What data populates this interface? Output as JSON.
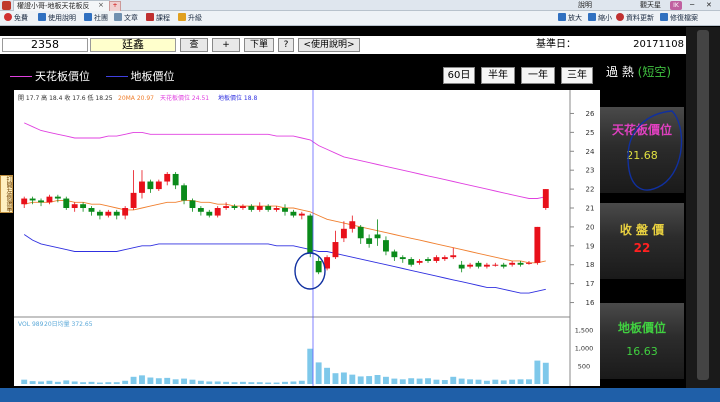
{
  "window": {
    "tab_title": "權證小哥-地板天花板反",
    "tab_close": "×"
  },
  "titlebar_right": {
    "help": "說明",
    "user": "觀天星",
    "user_badge": "IK"
  },
  "toolbar": {
    "items": [
      {
        "label": "免費",
        "color": "#d03030"
      },
      {
        "label": "使用說明",
        "color": "#3070c0"
      },
      {
        "label": "社團",
        "color": "#3070c0"
      },
      {
        "label": "文章",
        "color": "#3070c0"
      },
      {
        "label": "課程",
        "color": "#c03030"
      },
      {
        "label": "升級",
        "color": "#e0a020"
      }
    ],
    "right_items": [
      {
        "label": "放大",
        "color": "#3070c0"
      },
      {
        "label": "縮小",
        "color": "#3070c0"
      },
      {
        "label": "資料更新",
        "color": "#c03030"
      },
      {
        "label": "修復檔案",
        "color": "#3070c0"
      }
    ]
  },
  "quote": {
    "code": "2358",
    "name": "廷鑫",
    "query_btn": "查",
    "add_btn": "+",
    "menu_btn": "下單",
    "help_btn": "?",
    "manual_btn": "<使用說明>",
    "base_label": "基準日：",
    "base_date": "20171108"
  },
  "legend": {
    "ceiling": "天花板價位",
    "floor": "地板價位"
  },
  "periods": [
    "60日",
    "半年",
    "一年",
    "三年"
  ],
  "chart_header": {
    "ohlc": "開 17.7  高 18.4  收 17.6  低 18.25",
    "ma": "20MA 20.97",
    "ceil": "天花板價位 24.51",
    "floor": "地板價位 18.8"
  },
  "volume_header": {
    "vol": "VOL 989",
    "ma": "20日均量 372.65"
  },
  "sidebar_tab": "打開左側選單",
  "panel": {
    "status_prefix": "過  熱",
    "status_suffix": "(短空)",
    "ceiling_label": "天花板價位",
    "ceiling_value": "21.68",
    "close_label": "收 盤 價",
    "close_value": "22",
    "floor_label": "地板價位",
    "floor_value": "16.63"
  },
  "colors": {
    "up": "#e8101a",
    "down": "#0a8a1a",
    "ceiling": "#e040e0",
    "floor": "#3030e0",
    "ma": "#f08030",
    "status_hot": "#ffffff",
    "status_paren": "#40c040",
    "ceiling_label": "#e040c0",
    "close_label": "#e8d040",
    "floor_label": "#40d040",
    "volume": "#7ec8ea"
  },
  "chart_data": {
    "type": "candlestick",
    "y_ticks": [
      16,
      17,
      18,
      19,
      20,
      21,
      22,
      23,
      24,
      25,
      26
    ],
    "ylim": [
      15.5,
      26.5
    ],
    "volume_ticks": [
      "1,500",
      "1,000",
      "500"
    ],
    "volume_max": 1500,
    "candles": [
      [
        21.2,
        21.5,
        21.0,
        21.6
      ],
      [
        21.5,
        21.4,
        21.2,
        21.6
      ],
      [
        21.4,
        21.3,
        21.1,
        21.5
      ],
      [
        21.3,
        21.6,
        21.2,
        21.7
      ],
      [
        21.6,
        21.5,
        21.3,
        21.7
      ],
      [
        21.5,
        21.0,
        20.9,
        21.6
      ],
      [
        21.0,
        21.2,
        20.8,
        21.3
      ],
      [
        21.2,
        21.0,
        20.8,
        21.3
      ],
      [
        21.0,
        20.8,
        20.6,
        21.1
      ],
      [
        20.8,
        20.6,
        20.4,
        20.9
      ],
      [
        20.6,
        20.8,
        20.5,
        20.9
      ],
      [
        20.8,
        20.6,
        20.4,
        20.9
      ],
      [
        20.6,
        21.0,
        20.4,
        21.1
      ],
      [
        21.0,
        21.8,
        20.9,
        23.0
      ],
      [
        21.8,
        22.4,
        21.5,
        23.0
      ],
      [
        22.4,
        22.0,
        21.8,
        22.5
      ],
      [
        22.0,
        22.4,
        21.9,
        22.5
      ],
      [
        22.4,
        22.8,
        22.2,
        22.9
      ],
      [
        22.8,
        22.2,
        22.0,
        22.9
      ],
      [
        22.2,
        21.4,
        21.2,
        22.3
      ],
      [
        21.4,
        21.0,
        20.8,
        21.5
      ],
      [
        21.0,
        20.8,
        20.6,
        21.1
      ],
      [
        20.8,
        20.6,
        20.5,
        20.9
      ],
      [
        20.6,
        21.0,
        20.5,
        21.1
      ],
      [
        21.0,
        21.1,
        20.9,
        21.3
      ],
      [
        21.1,
        21.0,
        20.9,
        21.2
      ],
      [
        21.0,
        21.1,
        20.9,
        21.2
      ],
      [
        21.1,
        20.9,
        20.8,
        21.2
      ],
      [
        20.9,
        21.1,
        20.8,
        21.3
      ],
      [
        21.1,
        20.9,
        20.8,
        21.2
      ],
      [
        20.9,
        21.0,
        20.8,
        21.1
      ],
      [
        21.0,
        20.8,
        20.6,
        21.2
      ],
      [
        20.8,
        20.6,
        20.5,
        20.9
      ],
      [
        20.6,
        20.7,
        20.4,
        20.8
      ],
      [
        20.6,
        18.6,
        18.4,
        20.7
      ],
      [
        18.2,
        17.6,
        17.5,
        18.4
      ],
      [
        17.8,
        18.4,
        17.7,
        18.5
      ],
      [
        18.4,
        19.2,
        18.3,
        19.8
      ],
      [
        19.4,
        19.9,
        19.2,
        20.3
      ],
      [
        19.9,
        20.3,
        19.7,
        20.6
      ],
      [
        20.0,
        19.4,
        19.1,
        20.1
      ],
      [
        19.4,
        19.1,
        18.9,
        19.6
      ],
      [
        19.6,
        19.4,
        19.0,
        20.4
      ],
      [
        19.3,
        18.7,
        18.5,
        19.5
      ],
      [
        18.7,
        18.4,
        18.2,
        18.8
      ],
      [
        18.4,
        18.3,
        18.1,
        18.5
      ],
      [
        18.3,
        18.0,
        17.9,
        18.4
      ],
      [
        18.1,
        18.2,
        18.0,
        18.3
      ],
      [
        18.3,
        18.2,
        18.1,
        18.4
      ],
      [
        18.2,
        18.4,
        18.1,
        18.5
      ],
      [
        18.3,
        18.4,
        18.2,
        18.5
      ],
      [
        18.4,
        18.5,
        18.3,
        18.9
      ],
      [
        18.0,
        17.8,
        17.6,
        18.2
      ],
      [
        17.9,
        18.0,
        17.8,
        18.1
      ],
      [
        18.1,
        17.9,
        17.8,
        18.2
      ],
      [
        17.9,
        18.0,
        17.8,
        18.1
      ],
      [
        18.0,
        18.0,
        17.9,
        18.1
      ],
      [
        18.0,
        17.9,
        17.8,
        18.1
      ],
      [
        18.0,
        18.1,
        17.9,
        18.2
      ],
      [
        18.1,
        18.0,
        17.9,
        18.2
      ],
      [
        18.1,
        18.1,
        18.0,
        18.2
      ],
      [
        18.1,
        20.0,
        18.0,
        20.0
      ],
      [
        21.0,
        22.0,
        20.9,
        22.0
      ]
    ],
    "volumes": [
      120,
      80,
      70,
      90,
      60,
      100,
      70,
      50,
      60,
      40,
      50,
      50,
      90,
      200,
      240,
      180,
      160,
      170,
      130,
      150,
      120,
      90,
      70,
      70,
      60,
      50,
      60,
      50,
      50,
      40,
      40,
      60,
      70,
      90,
      980,
      600,
      450,
      300,
      320,
      260,
      210,
      220,
      250,
      200,
      150,
      130,
      160,
      150,
      160,
      120,
      110,
      200,
      150,
      130,
      120,
      90,
      120,
      100,
      120,
      130,
      130,
      650,
      590
    ],
    "ceiling_line": [
      25.5,
      25.3,
      25.1,
      25.0,
      24.9,
      24.8,
      24.7,
      24.7,
      24.7,
      24.7,
      24.8,
      24.8,
      24.9,
      25.0,
      25.0,
      24.9,
      24.9,
      24.9,
      24.9,
      24.9,
      24.9,
      24.9,
      24.9,
      24.9,
      24.9,
      24.9,
      24.9,
      24.9,
      24.9,
      24.9,
      24.8,
      24.8,
      24.8,
      24.7,
      24.6,
      24.3,
      24.1,
      23.9,
      23.7,
      23.6,
      23.5,
      23.4,
      23.3,
      23.2,
      23.1,
      23.0,
      22.9,
      22.8,
      22.7,
      22.6,
      22.5,
      22.4,
      22.3,
      22.2,
      22.1,
      22.0,
      21.9,
      21.8,
      21.7,
      21.6,
      21.5,
      21.5,
      21.6
    ],
    "floor_line": [
      19.6,
      19.3,
      19.1,
      19.0,
      18.9,
      18.8,
      18.7,
      18.7,
      18.7,
      18.7,
      18.7,
      18.7,
      18.8,
      18.9,
      19.0,
      19.0,
      19.1,
      19.1,
      19.1,
      19.1,
      19.1,
      19.1,
      19.1,
      19.1,
      19.1,
      19.1,
      19.1,
      19.1,
      19.1,
      19.1,
      19.0,
      19.0,
      19.0,
      18.9,
      18.8,
      18.7,
      18.7,
      18.6,
      18.5,
      18.4,
      18.3,
      18.2,
      18.1,
      18.0,
      17.9,
      17.8,
      17.7,
      17.6,
      17.5,
      17.4,
      17.3,
      17.2,
      17.1,
      17.0,
      16.9,
      16.8,
      16.8,
      16.7,
      16.6,
      16.5,
      16.5,
      16.6,
      16.7
    ],
    "ma_line": [
      21.2,
      21.3,
      21.3,
      21.3,
      21.4,
      21.4,
      21.3,
      21.3,
      21.2,
      21.2,
      21.1,
      21.0,
      20.9,
      20.9,
      21.0,
      21.1,
      21.2,
      21.3,
      21.3,
      21.4,
      21.4,
      21.3,
      21.3,
      21.2,
      21.2,
      21.1,
      21.1,
      21.1,
      21.1,
      21.1,
      21.1,
      21.0,
      21.0,
      20.9,
      20.8,
      20.6,
      20.4,
      20.3,
      20.2,
      20.1,
      20.0,
      19.9,
      19.8,
      19.7,
      19.6,
      19.5,
      19.4,
      19.3,
      19.2,
      19.1,
      19.0,
      18.9,
      18.8,
      18.7,
      18.6,
      18.5,
      18.4,
      18.3,
      18.2,
      18.2,
      18.1,
      18.1,
      18.2
    ]
  }
}
